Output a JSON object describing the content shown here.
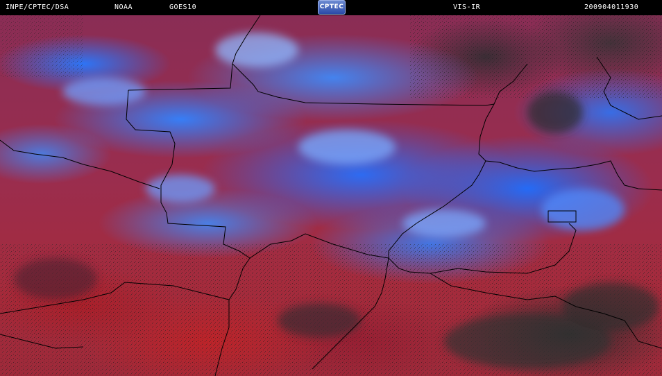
{
  "header": {
    "source": "INPE/CPTEC/DSA",
    "agency": "NOAA",
    "satellite": "GOES10",
    "logo_text": "CPTEC",
    "channel": "VIS-IR",
    "timestamp": "200904011930"
  },
  "colors": {
    "header_bg": "#000000",
    "header_text": "#ffffff",
    "cloud_blue": "#2f7cff",
    "ground_red": "#a52b3c",
    "border_line": "#000000"
  }
}
